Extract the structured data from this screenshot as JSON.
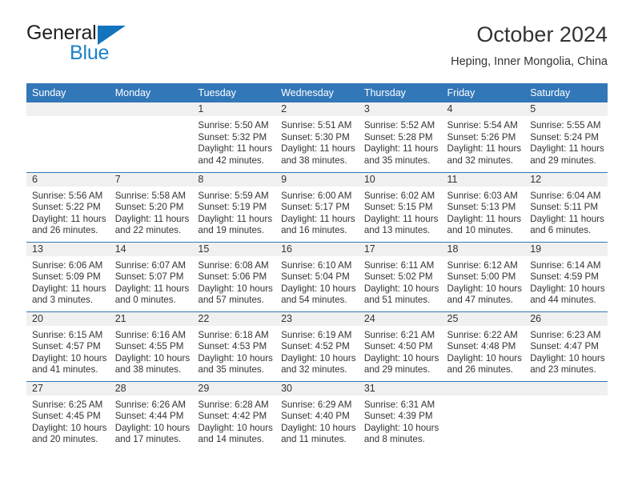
{
  "brand": {
    "name_top": "General",
    "name_bottom": "Blue",
    "triangle_color": "#1274bc",
    "blue_text_color": "#1c81c9",
    "top_text_color": "#231f20"
  },
  "header": {
    "month_title": "October 2024",
    "location": "Heping, Inner Mongolia, China"
  },
  "theme": {
    "header_blue": "#3277b8",
    "daynum_band": "#f0f0f0",
    "text": "#333333"
  },
  "weekdays": [
    "Sunday",
    "Monday",
    "Tuesday",
    "Wednesday",
    "Thursday",
    "Friday",
    "Saturday"
  ],
  "weeks": [
    [
      {
        "day": "",
        "blank": true,
        "lines": []
      },
      {
        "day": "",
        "blank": true,
        "lines": []
      },
      {
        "day": "1",
        "lines": [
          "Sunrise: 5:50 AM",
          "Sunset: 5:32 PM",
          "Daylight: 11 hours",
          "and 42 minutes."
        ]
      },
      {
        "day": "2",
        "lines": [
          "Sunrise: 5:51 AM",
          "Sunset: 5:30 PM",
          "Daylight: 11 hours",
          "and 38 minutes."
        ]
      },
      {
        "day": "3",
        "lines": [
          "Sunrise: 5:52 AM",
          "Sunset: 5:28 PM",
          "Daylight: 11 hours",
          "and 35 minutes."
        ]
      },
      {
        "day": "4",
        "lines": [
          "Sunrise: 5:54 AM",
          "Sunset: 5:26 PM",
          "Daylight: 11 hours",
          "and 32 minutes."
        ]
      },
      {
        "day": "5",
        "lines": [
          "Sunrise: 5:55 AM",
          "Sunset: 5:24 PM",
          "Daylight: 11 hours",
          "and 29 minutes."
        ]
      }
    ],
    [
      {
        "day": "6",
        "lines": [
          "Sunrise: 5:56 AM",
          "Sunset: 5:22 PM",
          "Daylight: 11 hours",
          "and 26 minutes."
        ]
      },
      {
        "day": "7",
        "lines": [
          "Sunrise: 5:58 AM",
          "Sunset: 5:20 PM",
          "Daylight: 11 hours",
          "and 22 minutes."
        ]
      },
      {
        "day": "8",
        "lines": [
          "Sunrise: 5:59 AM",
          "Sunset: 5:19 PM",
          "Daylight: 11 hours",
          "and 19 minutes."
        ]
      },
      {
        "day": "9",
        "lines": [
          "Sunrise: 6:00 AM",
          "Sunset: 5:17 PM",
          "Daylight: 11 hours",
          "and 16 minutes."
        ]
      },
      {
        "day": "10",
        "lines": [
          "Sunrise: 6:02 AM",
          "Sunset: 5:15 PM",
          "Daylight: 11 hours",
          "and 13 minutes."
        ]
      },
      {
        "day": "11",
        "lines": [
          "Sunrise: 6:03 AM",
          "Sunset: 5:13 PM",
          "Daylight: 11 hours",
          "and 10 minutes."
        ]
      },
      {
        "day": "12",
        "lines": [
          "Sunrise: 6:04 AM",
          "Sunset: 5:11 PM",
          "Daylight: 11 hours",
          "and 6 minutes."
        ]
      }
    ],
    [
      {
        "day": "13",
        "lines": [
          "Sunrise: 6:06 AM",
          "Sunset: 5:09 PM",
          "Daylight: 11 hours",
          "and 3 minutes."
        ]
      },
      {
        "day": "14",
        "lines": [
          "Sunrise: 6:07 AM",
          "Sunset: 5:07 PM",
          "Daylight: 11 hours",
          "and 0 minutes."
        ]
      },
      {
        "day": "15",
        "lines": [
          "Sunrise: 6:08 AM",
          "Sunset: 5:06 PM",
          "Daylight: 10 hours",
          "and 57 minutes."
        ]
      },
      {
        "day": "16",
        "lines": [
          "Sunrise: 6:10 AM",
          "Sunset: 5:04 PM",
          "Daylight: 10 hours",
          "and 54 minutes."
        ]
      },
      {
        "day": "17",
        "lines": [
          "Sunrise: 6:11 AM",
          "Sunset: 5:02 PM",
          "Daylight: 10 hours",
          "and 51 minutes."
        ]
      },
      {
        "day": "18",
        "lines": [
          "Sunrise: 6:12 AM",
          "Sunset: 5:00 PM",
          "Daylight: 10 hours",
          "and 47 minutes."
        ]
      },
      {
        "day": "19",
        "lines": [
          "Sunrise: 6:14 AM",
          "Sunset: 4:59 PM",
          "Daylight: 10 hours",
          "and 44 minutes."
        ]
      }
    ],
    [
      {
        "day": "20",
        "lines": [
          "Sunrise: 6:15 AM",
          "Sunset: 4:57 PM",
          "Daylight: 10 hours",
          "and 41 minutes."
        ]
      },
      {
        "day": "21",
        "lines": [
          "Sunrise: 6:16 AM",
          "Sunset: 4:55 PM",
          "Daylight: 10 hours",
          "and 38 minutes."
        ]
      },
      {
        "day": "22",
        "lines": [
          "Sunrise: 6:18 AM",
          "Sunset: 4:53 PM",
          "Daylight: 10 hours",
          "and 35 minutes."
        ]
      },
      {
        "day": "23",
        "lines": [
          "Sunrise: 6:19 AM",
          "Sunset: 4:52 PM",
          "Daylight: 10 hours",
          "and 32 minutes."
        ]
      },
      {
        "day": "24",
        "lines": [
          "Sunrise: 6:21 AM",
          "Sunset: 4:50 PM",
          "Daylight: 10 hours",
          "and 29 minutes."
        ]
      },
      {
        "day": "25",
        "lines": [
          "Sunrise: 6:22 AM",
          "Sunset: 4:48 PM",
          "Daylight: 10 hours",
          "and 26 minutes."
        ]
      },
      {
        "day": "26",
        "lines": [
          "Sunrise: 6:23 AM",
          "Sunset: 4:47 PM",
          "Daylight: 10 hours",
          "and 23 minutes."
        ]
      }
    ],
    [
      {
        "day": "27",
        "lines": [
          "Sunrise: 6:25 AM",
          "Sunset: 4:45 PM",
          "Daylight: 10 hours",
          "and 20 minutes."
        ]
      },
      {
        "day": "28",
        "lines": [
          "Sunrise: 6:26 AM",
          "Sunset: 4:44 PM",
          "Daylight: 10 hours",
          "and 17 minutes."
        ]
      },
      {
        "day": "29",
        "lines": [
          "Sunrise: 6:28 AM",
          "Sunset: 4:42 PM",
          "Daylight: 10 hours",
          "and 14 minutes."
        ]
      },
      {
        "day": "30",
        "lines": [
          "Sunrise: 6:29 AM",
          "Sunset: 4:40 PM",
          "Daylight: 10 hours",
          "and 11 minutes."
        ]
      },
      {
        "day": "31",
        "lines": [
          "Sunrise: 6:31 AM",
          "Sunset: 4:39 PM",
          "Daylight: 10 hours",
          "and 8 minutes."
        ]
      },
      {
        "day": "",
        "blank": true,
        "lines": []
      },
      {
        "day": "",
        "blank": true,
        "lines": []
      }
    ]
  ]
}
